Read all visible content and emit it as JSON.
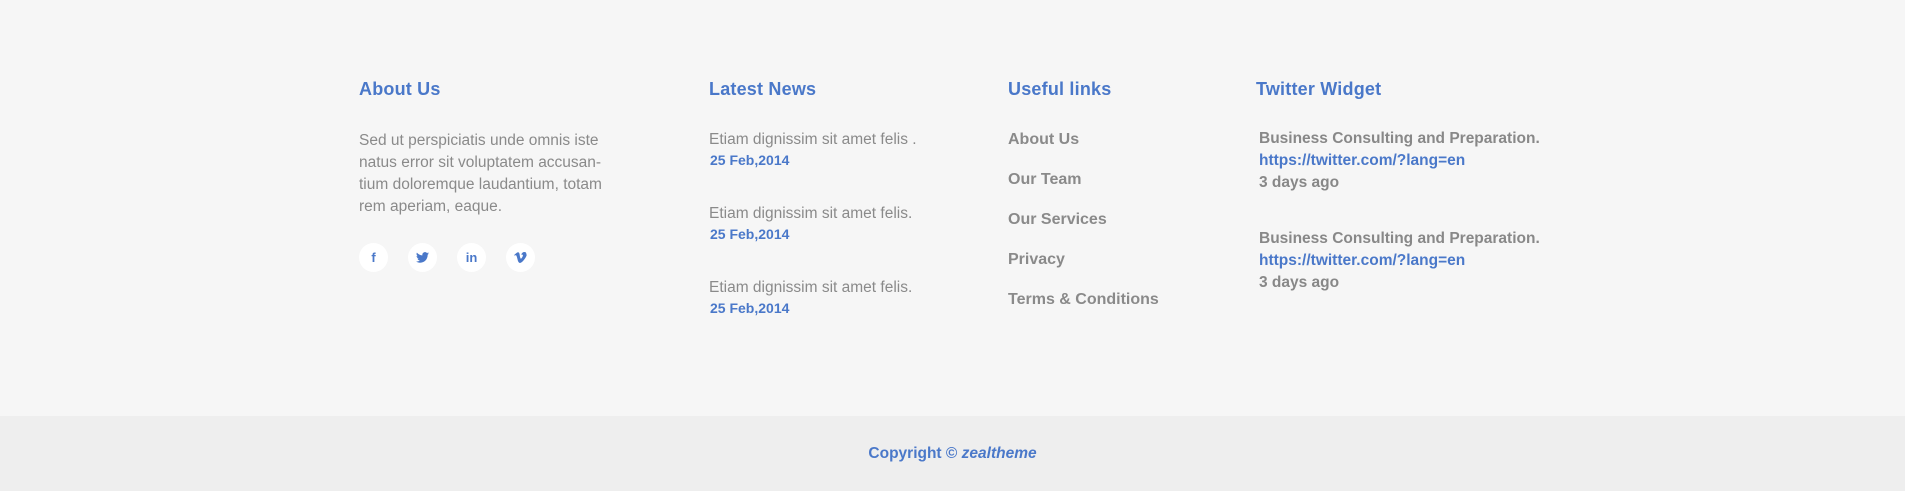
{
  "about": {
    "heading": "About Us",
    "text": "Sed ut perspiciatis unde omnis iste natus error sit voluptatem accusan-tium doloremque laudantium, totam rem aperiam, eaque.",
    "social": [
      {
        "icon": "facebook-icon",
        "glyph": "f"
      },
      {
        "icon": "twitter-icon",
        "glyph": "t"
      },
      {
        "icon": "linkedin-icon",
        "glyph": "in"
      },
      {
        "icon": "vimeo-icon",
        "glyph": "v"
      }
    ]
  },
  "news": {
    "heading": "Latest News",
    "items": [
      {
        "title": "Etiam dignissim sit amet felis .",
        "date": "25 Feb,2014"
      },
      {
        "title": "Etiam dignissim sit amet felis.",
        "date": "25 Feb,2014"
      },
      {
        "title": "Etiam dignissim sit amet felis.",
        "date": "25 Feb,2014"
      }
    ]
  },
  "links": {
    "heading": "Useful links",
    "items": [
      "About Us",
      "Our Team",
      "Our Services",
      "Privacy",
      "Terms & Conditions"
    ]
  },
  "twitter": {
    "heading": "Twitter Widget",
    "tweets": [
      {
        "text": "Business Consulting and Preparation.",
        "link": "https://twitter.com/?lang=en",
        "time": "3 days ago"
      },
      {
        "text": "Business Consulting and Preparation.",
        "link": "https://twitter.com/?lang=en",
        "time": "3 days ago"
      }
    ]
  },
  "footer": {
    "copyright": "Copyright ©",
    "brand": "zealtheme"
  },
  "colors": {
    "accent": "#4a78c9",
    "text_muted": "#8a8a8a",
    "background": "#f6f6f6",
    "bottom_bar": "#eeeeee"
  }
}
